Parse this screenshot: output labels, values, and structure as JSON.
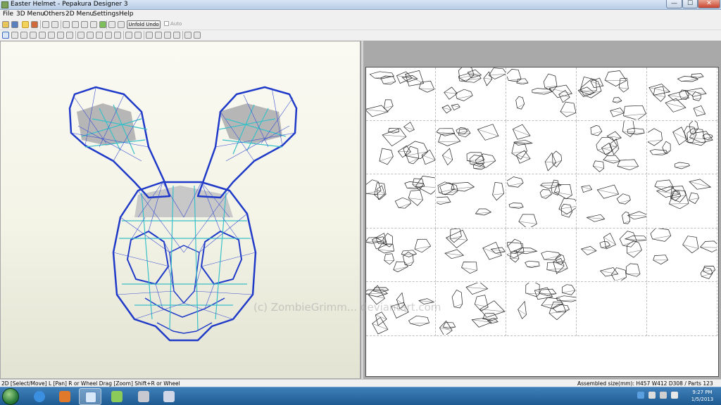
{
  "window": {
    "title": "Easter Helmet - Pepakura Designer 3",
    "controls": {
      "minimize": "—",
      "maximize": "☐",
      "close": "✕"
    }
  },
  "menu": [
    "File",
    "3D Menu",
    "Others",
    "2D Menu",
    "Settings",
    "Help"
  ],
  "toolbar": {
    "unfold_undo": "Unfold Undo",
    "auto": "Auto"
  },
  "watermark": {
    "text": "(c) ZombieGrimm... deviantart.com"
  },
  "status": {
    "left": "2D [Select/Move] L [Pan] R or Wheel Drag [Zoom] Shift+R or Wheel",
    "right": "Assembled size(mm): H457 W412 D308 / Parts 123"
  },
  "taskbar": {
    "apps": [
      "start-orb",
      "internet-explorer-icon",
      "media-player-icon",
      "pepakura-icon",
      "notepad-icon",
      "disk-icon",
      "calculator-icon"
    ],
    "time": "9:27 PM",
    "date": "1/5/2013"
  },
  "colors": {
    "mesh": "#1f3ac8",
    "fold": "#39c0c8",
    "shade": "#9a9a9a",
    "pane_bg": "#a9a9a9",
    "taskbar": "#2a66a0"
  },
  "pages": {
    "rows": 5,
    "cols": 5,
    "filled": 23
  }
}
